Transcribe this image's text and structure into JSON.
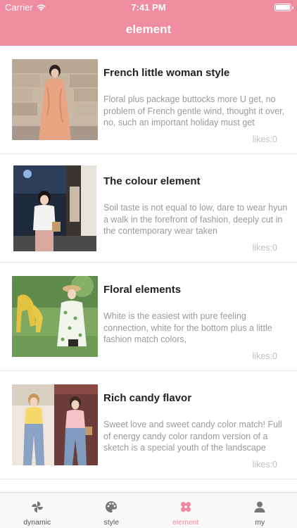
{
  "status_bar": {
    "carrier": "Carrier",
    "time": "7:41 PM"
  },
  "nav": {
    "title": "element"
  },
  "items": [
    {
      "title": "French little woman style",
      "description": "Floral plus package buttocks more U get, no problem of French gentle wind, thought it over, no, such an important holiday must get",
      "likes": "likes:0"
    },
    {
      "title": "The colour element",
      "description": "Soil taste is not equal to low, dare to wear hyun a walk in the forefront of fashion, deeply cut in the contemporary wear taken",
      "likes": "likes:0"
    },
    {
      "title": "Floral elements",
      "description": "White is the easiest with pure feeling connection, white for the bottom plus a little fashion match colors,",
      "likes": "likes:0"
    },
    {
      "title": "Rich candy flavor",
      "description": "Sweet love and sweet candy color match! Full of energy candy color random version of a sketch is a special youth of the landscape",
      "likes": "likes:0"
    }
  ],
  "tabs": [
    {
      "label": "dynamic",
      "icon": "pinwheel-icon",
      "active": false
    },
    {
      "label": "style",
      "icon": "palette-icon",
      "active": false
    },
    {
      "label": "element",
      "icon": "flower-icon",
      "active": true
    },
    {
      "label": "my",
      "icon": "person-icon",
      "active": false
    }
  ],
  "colors": {
    "accent": "#f08ca0",
    "tab_inactive": "#555555",
    "likes": "#c0c0c0"
  }
}
